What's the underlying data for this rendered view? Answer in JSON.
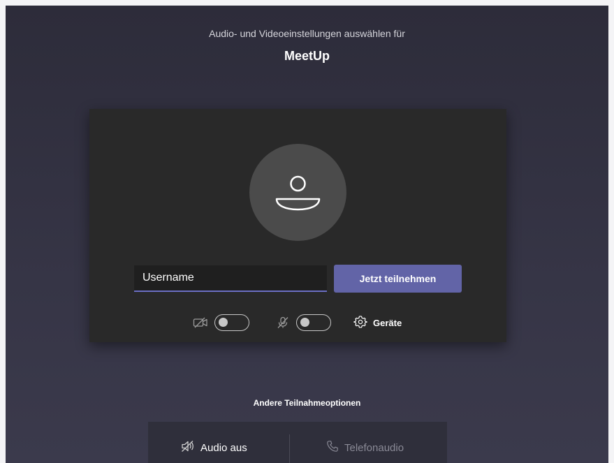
{
  "header": {
    "subtitle": "Audio- und Videoeinstellungen auswählen für",
    "meeting_title": "MeetUp"
  },
  "prejoin": {
    "avatar_icon": "user-avatar-icon",
    "name_input_value": "Username",
    "join_button_label": "Jetzt teilnehmen",
    "camera": {
      "icon": "video-off-icon",
      "enabled": false
    },
    "microphone": {
      "icon": "mic-off-icon",
      "enabled": false
    },
    "devices_icon": "gear-icon",
    "devices_label": "Geräte"
  },
  "other_options": {
    "heading": "Andere Teilnahmeoptionen",
    "audio_off_label": "Audio aus",
    "audio_off_icon": "speaker-off-icon",
    "phone_audio_label": "Telefonaudio",
    "phone_audio_icon": "phone-icon"
  },
  "colors": {
    "background": "#2d2c3a",
    "card": "#292929",
    "accent": "#6264a7"
  }
}
